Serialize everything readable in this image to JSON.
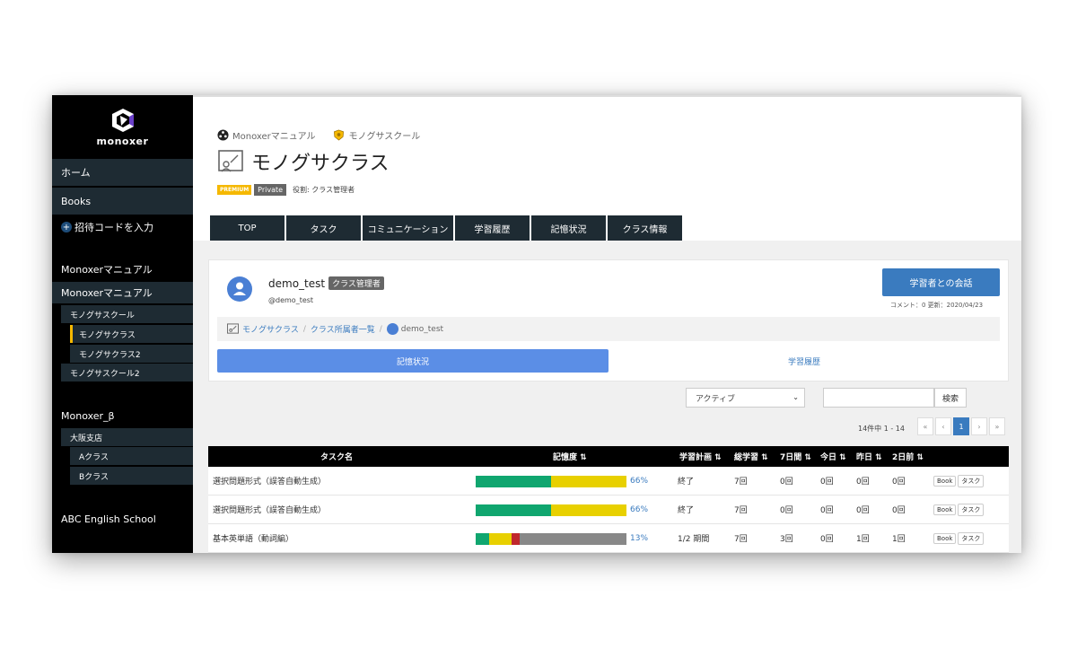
{
  "sidebar": {
    "logo_text": "monoxer",
    "items": {
      "home": "ホーム",
      "books": "Books",
      "invite": "招待コードを入力",
      "manual_heading": "Monoxerマニュアル",
      "manual": "Monoxerマニュアル",
      "school1": "モノグサスクール",
      "class1": "モノグサクラス",
      "class2": "モノグサクラス2",
      "school2": "モノグサスクール2",
      "beta_heading": "Monoxer_β",
      "osaka": "大阪支店",
      "class_a": "Aクラス",
      "class_b": "Bクラス",
      "abc": "ABC English School"
    }
  },
  "header": {
    "crumb1": "Monoxerマニュアル",
    "crumb2": "モノグサスクール",
    "title": "モノグサクラス",
    "badge_premium": "PREMIUM",
    "badge_private": "Private",
    "role": "役割: クラス管理者"
  },
  "tabs": [
    "TOP",
    "タスク",
    "コミュニケーション",
    "学習履歴",
    "記憶状況",
    "クラス情報"
  ],
  "user": {
    "name": "demo_test",
    "role_badge": "クラス管理者",
    "handle": "@demo_test",
    "talk_button": "学習者との会話",
    "meta": "コメント：0  更新：2020/04/23",
    "path_class": "モノグサクラス",
    "path_members": "クラス所属者一覧",
    "path_user": "demo_test",
    "subtab_active": "記憶状況",
    "subtab_other": "学習履歴"
  },
  "filter": {
    "select_value": "アクティブ",
    "search_button": "検索",
    "count": "14件中 1 - 14",
    "pager": [
      "«",
      "‹",
      "1",
      "›",
      "»"
    ]
  },
  "table": {
    "headers": {
      "task": "タスク名",
      "memory": "記憶度 ⇅",
      "plan": "学習計画 ⇅",
      "total": "総学習 ⇅",
      "days7": "7日間 ⇅",
      "today": "今日 ⇅",
      "yesterday": "昨日 ⇅",
      "days2": "2日前 ⇅"
    },
    "rows": [
      {
        "name": "選択問題形式（誤答自動生成）",
        "segments": [
          {
            "color": "#10a66f",
            "pct": 50
          },
          {
            "color": "#e8d000",
            "pct": 50
          }
        ],
        "pct": "66%",
        "plan": "終了",
        "total": "7回",
        "days7": "0回",
        "today": "0回",
        "yesterday": "0回",
        "days2": "0回",
        "btn_book": "Book",
        "btn_task": "タスク"
      },
      {
        "name": "選択問題形式（誤答自動生成）",
        "segments": [
          {
            "color": "#10a66f",
            "pct": 50
          },
          {
            "color": "#e8d000",
            "pct": 50
          }
        ],
        "pct": "66%",
        "plan": "終了",
        "total": "7回",
        "days7": "0回",
        "today": "0回",
        "yesterday": "0回",
        "days2": "0回",
        "btn_book": "Book",
        "btn_task": "タスク"
      },
      {
        "name": "基本英単語（動詞編）",
        "segments": [
          {
            "color": "#10a66f",
            "pct": 9
          },
          {
            "color": "#e8d000",
            "pct": 15
          },
          {
            "color": "#c0282d",
            "pct": 5
          },
          {
            "color": "#888888",
            "pct": 71
          }
        ],
        "pct": "13%",
        "plan": "1/2 期間",
        "total": "7回",
        "days7": "3回",
        "today": "0回",
        "yesterday": "1回",
        "days2": "1回",
        "btn_book": "Book",
        "btn_task": "タスク"
      }
    ]
  },
  "colors": {
    "sidebar_bg": "#000000",
    "nav_item": "#1e2b33",
    "accent_blue": "#3a7bbf",
    "active_subtab": "#5b8ee6",
    "premium": "#f5b800"
  }
}
